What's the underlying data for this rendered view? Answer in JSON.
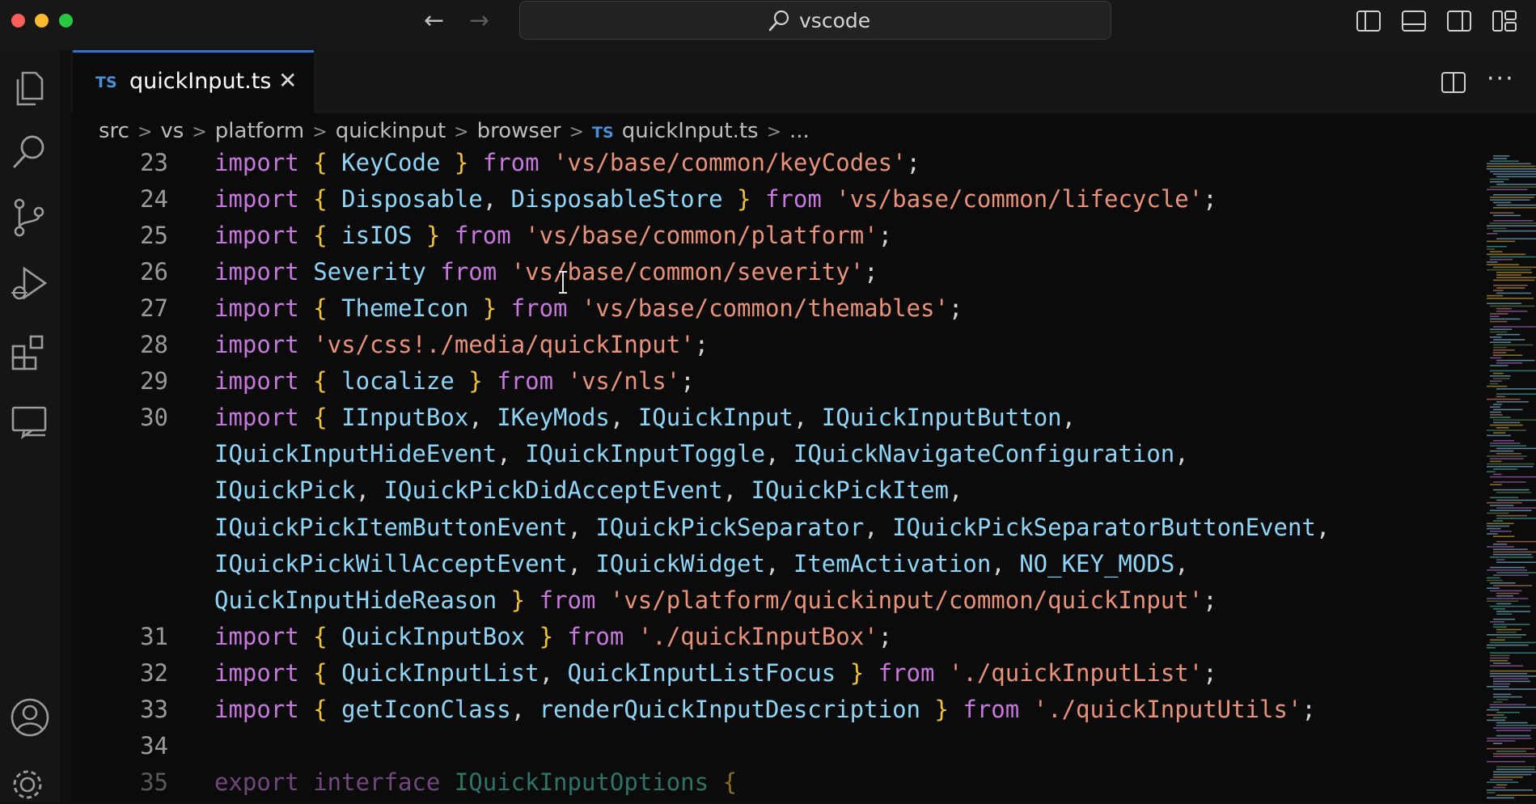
{
  "window": {
    "search_text": "vscode"
  },
  "tab": {
    "lang_badge": "TS",
    "file_name": "quickInput.ts",
    "close_glyph": "✕"
  },
  "editor_actions": {
    "more_glyph": "···"
  },
  "breadcrumb": {
    "items": [
      "src",
      "vs",
      "platform",
      "quickinput",
      "browser"
    ],
    "file_badge": "TS",
    "file": "quickInput.ts",
    "tail": "...",
    "separator": ">"
  },
  "code": {
    "lines": [
      {
        "num": "23",
        "tokens": [
          [
            "kw",
            "import "
          ],
          [
            "br",
            "{ "
          ],
          [
            "id",
            "KeyCode"
          ],
          [
            "br",
            " }"
          ],
          [
            "kw",
            " from "
          ],
          [
            "str",
            "'vs/base/common/keyCodes'"
          ],
          [
            "pn",
            ";"
          ]
        ]
      },
      {
        "num": "24",
        "tokens": [
          [
            "kw",
            "import "
          ],
          [
            "br",
            "{ "
          ],
          [
            "id",
            "Disposable"
          ],
          [
            "pn",
            ", "
          ],
          [
            "id",
            "DisposableStore"
          ],
          [
            "br",
            " }"
          ],
          [
            "kw",
            " from "
          ],
          [
            "str",
            "'vs/base/common/lifecycle'"
          ],
          [
            "pn",
            ";"
          ]
        ]
      },
      {
        "num": "25",
        "tokens": [
          [
            "kw",
            "import "
          ],
          [
            "br",
            "{ "
          ],
          [
            "id",
            "isIOS"
          ],
          [
            "br",
            " }"
          ],
          [
            "kw",
            " from "
          ],
          [
            "str",
            "'vs/base/common/platform'"
          ],
          [
            "pn",
            ";"
          ]
        ]
      },
      {
        "num": "26",
        "tokens": [
          [
            "kw",
            "import "
          ],
          [
            "id",
            "Severity"
          ],
          [
            "kw",
            " from "
          ],
          [
            "str",
            "'vs/base/common/severity'"
          ],
          [
            "pn",
            ";"
          ]
        ]
      },
      {
        "num": "27",
        "tokens": [
          [
            "kw",
            "import "
          ],
          [
            "br",
            "{ "
          ],
          [
            "id",
            "ThemeIcon"
          ],
          [
            "br",
            " }"
          ],
          [
            "kw",
            " from "
          ],
          [
            "str",
            "'vs/base/common/themables'"
          ],
          [
            "pn",
            ";"
          ]
        ]
      },
      {
        "num": "28",
        "tokens": [
          [
            "kw",
            "import "
          ],
          [
            "str",
            "'vs/css!./media/quickInput'"
          ],
          [
            "pn",
            ";"
          ]
        ]
      },
      {
        "num": "29",
        "tokens": [
          [
            "kw",
            "import "
          ],
          [
            "br",
            "{ "
          ],
          [
            "id",
            "localize"
          ],
          [
            "br",
            " }"
          ],
          [
            "kw",
            " from "
          ],
          [
            "str",
            "'vs/nls'"
          ],
          [
            "pn",
            ";"
          ]
        ]
      },
      {
        "num": "30",
        "tokens": [
          [
            "kw",
            "import "
          ],
          [
            "br",
            "{ "
          ],
          [
            "id",
            "IInputBox"
          ],
          [
            "pn",
            ", "
          ],
          [
            "id",
            "IKeyMods"
          ],
          [
            "pn",
            ", "
          ],
          [
            "id",
            "IQuickInput"
          ],
          [
            "pn",
            ", "
          ],
          [
            "id",
            "IQuickInputButton"
          ],
          [
            "pn",
            ","
          ]
        ]
      },
      {
        "num": "",
        "tokens": [
          [
            "id",
            "IQuickInputHideEvent"
          ],
          [
            "pn",
            ", "
          ],
          [
            "id",
            "IQuickInputToggle"
          ],
          [
            "pn",
            ", "
          ],
          [
            "id",
            "IQuickNavigateConfiguration"
          ],
          [
            "pn",
            ","
          ]
        ]
      },
      {
        "num": "",
        "tokens": [
          [
            "id",
            "IQuickPick"
          ],
          [
            "pn",
            ", "
          ],
          [
            "id",
            "IQuickPickDidAcceptEvent"
          ],
          [
            "pn",
            ", "
          ],
          [
            "id",
            "IQuickPickItem"
          ],
          [
            "pn",
            ","
          ]
        ]
      },
      {
        "num": "",
        "tokens": [
          [
            "id",
            "IQuickPickItemButtonEvent"
          ],
          [
            "pn",
            ", "
          ],
          [
            "id",
            "IQuickPickSeparator"
          ],
          [
            "pn",
            ", "
          ],
          [
            "id",
            "IQuickPickSeparatorButtonEvent"
          ],
          [
            "pn",
            ","
          ]
        ]
      },
      {
        "num": "",
        "tokens": [
          [
            "id",
            "IQuickPickWillAcceptEvent"
          ],
          [
            "pn",
            ", "
          ],
          [
            "id",
            "IQuickWidget"
          ],
          [
            "pn",
            ", "
          ],
          [
            "id",
            "ItemActivation"
          ],
          [
            "pn",
            ", "
          ],
          [
            "id",
            "NO_KEY_MODS"
          ],
          [
            "pn",
            ","
          ]
        ]
      },
      {
        "num": "",
        "tokens": [
          [
            "id",
            "QuickInputHideReason"
          ],
          [
            "br",
            " }"
          ],
          [
            "kw",
            " from "
          ],
          [
            "str",
            "'vs/platform/quickinput/common/quickInput'"
          ],
          [
            "pn",
            ";"
          ]
        ]
      },
      {
        "num": "31",
        "tokens": [
          [
            "kw",
            "import "
          ],
          [
            "br",
            "{ "
          ],
          [
            "id",
            "QuickInputBox"
          ],
          [
            "br",
            " }"
          ],
          [
            "kw",
            " from "
          ],
          [
            "str",
            "'./quickInputBox'"
          ],
          [
            "pn",
            ";"
          ]
        ]
      },
      {
        "num": "32",
        "tokens": [
          [
            "kw",
            "import "
          ],
          [
            "br",
            "{ "
          ],
          [
            "id",
            "QuickInputList"
          ],
          [
            "pn",
            ", "
          ],
          [
            "id",
            "QuickInputListFocus"
          ],
          [
            "br",
            " }"
          ],
          [
            "kw",
            " from "
          ],
          [
            "str",
            "'./quickInputList'"
          ],
          [
            "pn",
            ";"
          ]
        ]
      },
      {
        "num": "33",
        "tokens": [
          [
            "kw",
            "import "
          ],
          [
            "br",
            "{ "
          ],
          [
            "id",
            "getIconClass"
          ],
          [
            "pn",
            ", "
          ],
          [
            "id",
            "renderQuickInputDescription"
          ],
          [
            "br",
            " }"
          ],
          [
            "kw",
            " from "
          ],
          [
            "str",
            "'./quickInputUtils'"
          ],
          [
            "pn",
            ";"
          ]
        ]
      },
      {
        "num": "34",
        "tokens": []
      },
      {
        "num": "35",
        "tokens": [
          [
            "kw",
            "export "
          ],
          [
            "kw",
            "interface "
          ],
          [
            "ty",
            "IQuickInputOptions"
          ],
          [
            "br",
            " {"
          ]
        ]
      }
    ]
  },
  "colors": {
    "keyword": "#c678dd",
    "bracket": "#f1c232",
    "identifier": "#8ed5f7",
    "string": "#e8927a",
    "accent": "#2f74d0"
  },
  "icons": {
    "activity": [
      "explorer-icon",
      "search-icon",
      "source-control-icon",
      "run-debug-icon",
      "extensions-icon",
      "remote-explorer-icon",
      "account-icon",
      "manage-gear-icon"
    ],
    "titlebar": [
      "toggle-primary-sidebar-icon",
      "toggle-panel-icon",
      "toggle-secondary-sidebar-icon",
      "customize-layout-icon"
    ]
  }
}
